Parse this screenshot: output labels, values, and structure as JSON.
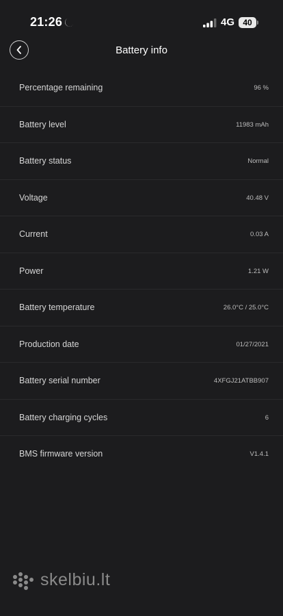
{
  "status_bar": {
    "time": "21:26",
    "network": "4G",
    "battery_level": "40"
  },
  "header": {
    "title": "Battery info"
  },
  "rows": [
    {
      "label": "Percentage remaining",
      "value": "96 %"
    },
    {
      "label": "Battery level",
      "value": "11983 mAh"
    },
    {
      "label": "Battery status",
      "value": "Normal"
    },
    {
      "label": "Voltage",
      "value": "40.48 V"
    },
    {
      "label": "Current",
      "value": "0.03 A"
    },
    {
      "label": "Power",
      "value": "1.21 W"
    },
    {
      "label": "Battery temperature",
      "value": "26.0°C / 25.0°C"
    },
    {
      "label": "Production date",
      "value": "01/27/2021"
    },
    {
      "label": "Battery serial number",
      "value": "4XFGJ21ATBB907"
    },
    {
      "label": "Battery charging cycles",
      "value": "6"
    },
    {
      "label": "BMS firmware version",
      "value": "V1.4.1"
    }
  ],
  "watermark": {
    "text": "skelbiu.lt"
  },
  "colors": {
    "background": "#1c1c1e",
    "divider": "#2a2a2c",
    "text": "#d6d6d6"
  }
}
